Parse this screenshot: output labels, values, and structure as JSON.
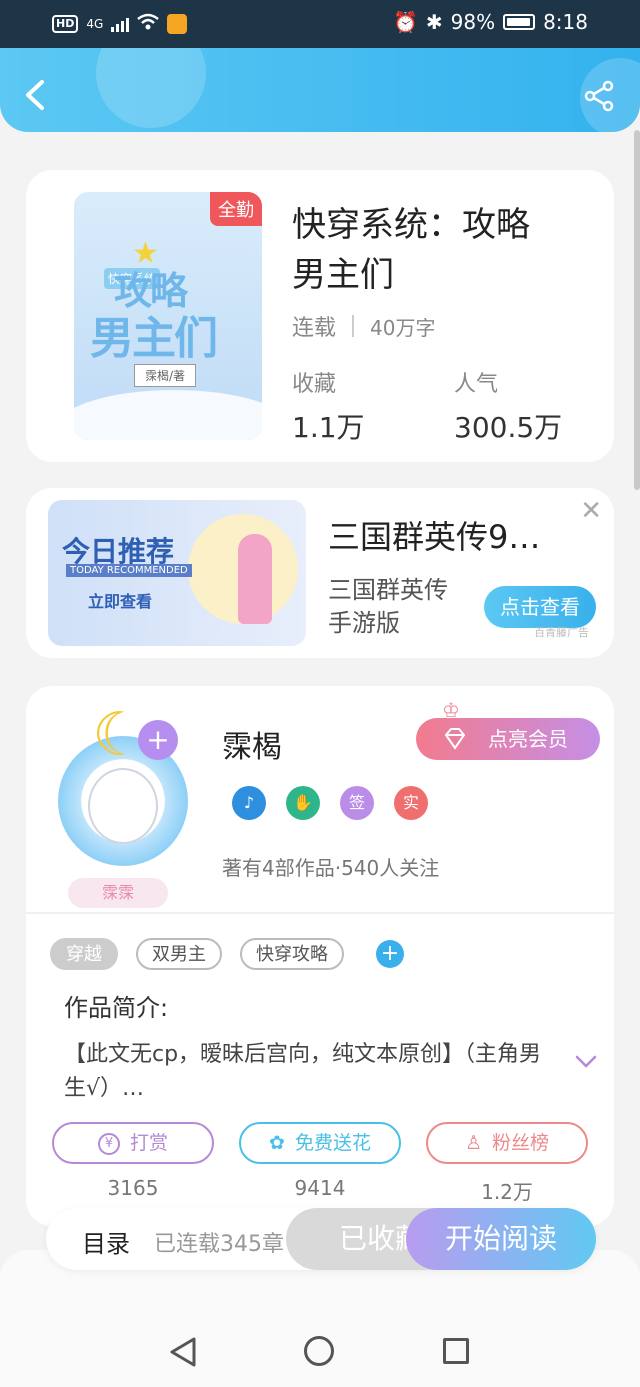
{
  "status_bar": {
    "network": "HD",
    "signal": "4G",
    "battery": "98%",
    "time": "8:18"
  },
  "book": {
    "cover_badge": "全勤",
    "cover_title_line1": "攻略",
    "cover_title_line2": "男主们",
    "cover_small": "快穿系统",
    "cover_author": "霂楬/著",
    "title": "快穿系统：攻略男主们",
    "status": "连载",
    "word_count": "40万字",
    "favorites_label": "收藏",
    "favorites_value": "1.1万",
    "popularity_label": "人气",
    "popularity_value": "300.5万"
  },
  "ad": {
    "image_title": "今日推荐",
    "image_subtitle": "TODAY RECOMMENDED",
    "image_cta": "立即查看",
    "title": "三国群英传9…",
    "description": "三国群英传手游版",
    "button": "点击查看",
    "close": "✕",
    "source": "百青藤广告"
  },
  "author": {
    "avatar_tag": "霂霂",
    "avatar_plus": "+",
    "name": "霂楬",
    "vip_button": "点亮会员",
    "badges": [
      {
        "label": "♪",
        "color": "#2e8fe0"
      },
      {
        "label": "✋",
        "color": "#2fb58c"
      },
      {
        "label": "签",
        "color": "#b98de8"
      },
      {
        "label": "实",
        "color": "#ef6f6f"
      }
    ],
    "stats": "著有4部作品·540人关注"
  },
  "tags": [
    "穿越",
    "双男主",
    "快穿攻略"
  ],
  "tag_add": "+",
  "intro": {
    "title": "作品简介:",
    "text": "【此文无cp，暧昧后宫向，纯文本原创】（主角男生√）…"
  },
  "actions": [
    {
      "icon": "¥",
      "label": "打赏",
      "count": "3165",
      "color": "#b48ad6"
    },
    {
      "icon": "✿",
      "label": "免费送花",
      "count": "9414",
      "color": "#49c0e8"
    },
    {
      "icon": "♙",
      "label": "粉丝榜",
      "count": "1.2万",
      "color": "#ec8a8a"
    }
  ],
  "bottom_bar": {
    "toc": "目录",
    "toc_status": "已连载345章",
    "favorited": "已收藏",
    "start_reading": "开始阅读"
  },
  "colors": {
    "header": "#33b2ee",
    "accent_purple": "#b89cf0",
    "cover_badge": "#f0575b"
  }
}
